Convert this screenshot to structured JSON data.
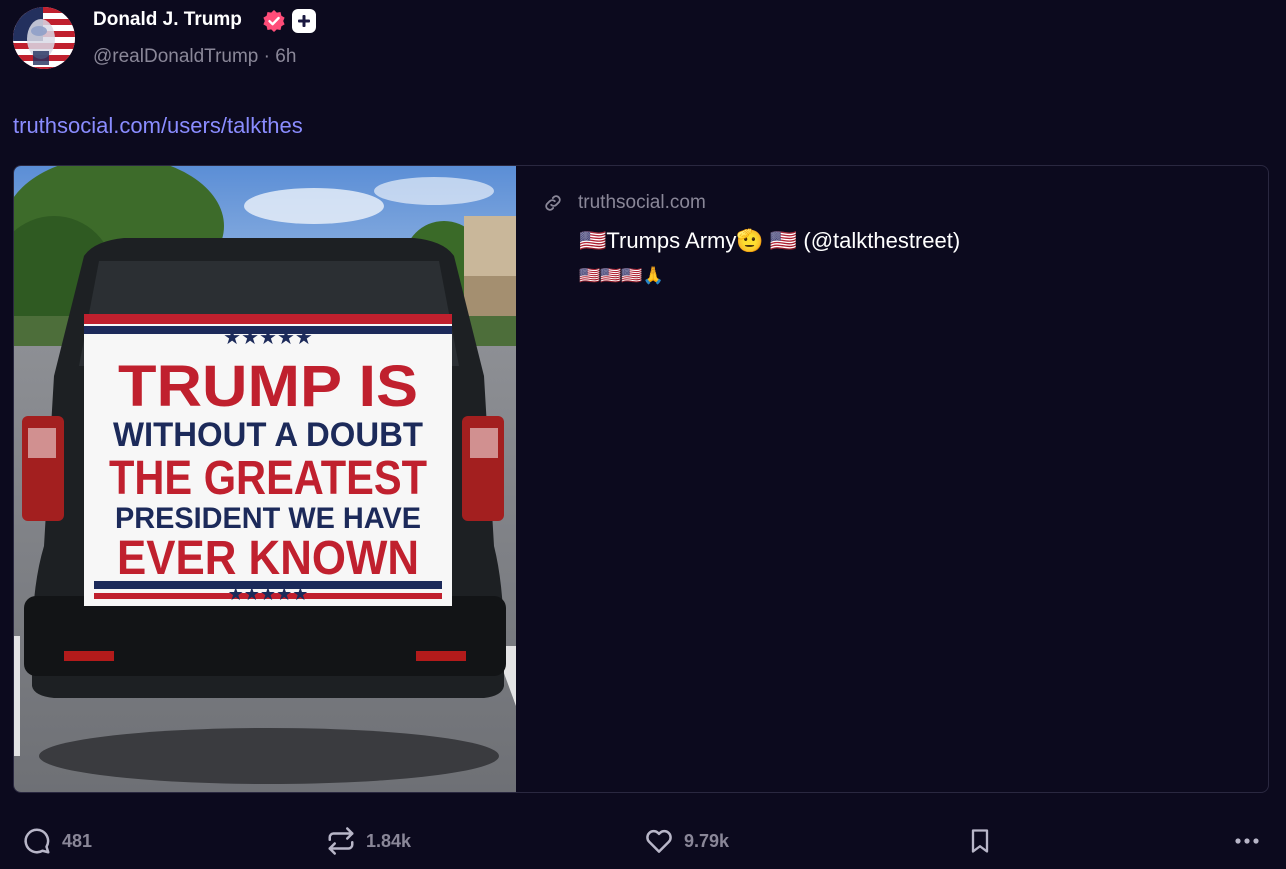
{
  "author": {
    "display_name": "Donald J. Trump",
    "handle": "@realDonaldTrump",
    "separator": "·",
    "time_ago": "6h"
  },
  "post": {
    "link_text": "truthsocial.com/users/talkthes"
  },
  "card": {
    "domain": "truthsocial.com",
    "title": "🇺🇸Trumps Army🫡 🇺🇸 (@talkthestreet)",
    "description": "🇺🇸🇺🇸🇺🇸🙏",
    "image_text": {
      "line1": "TRUMP IS",
      "line2": "WITHOUT A DOUBT",
      "line3": "THE GREATEST",
      "line4": "PRESIDENT WE HAVE",
      "line5": "EVER KNOWN"
    }
  },
  "actions": {
    "replies": "481",
    "retruths": "1.84k",
    "likes": "9.79k"
  },
  "icons": {
    "avatar": "avatar-flag-portrait",
    "verified": "verified-badge-icon",
    "plus": "plus-badge-icon",
    "link": "link-icon",
    "reply": "reply-icon",
    "retruth": "retruth-icon",
    "like": "heart-icon",
    "bookmark": "bookmark-icon",
    "more": "more-icon"
  },
  "colors": {
    "background": "#0c0a1e",
    "accent_link": "#8a8cff",
    "muted": "#8a8798",
    "verified": "#ff4d79"
  }
}
